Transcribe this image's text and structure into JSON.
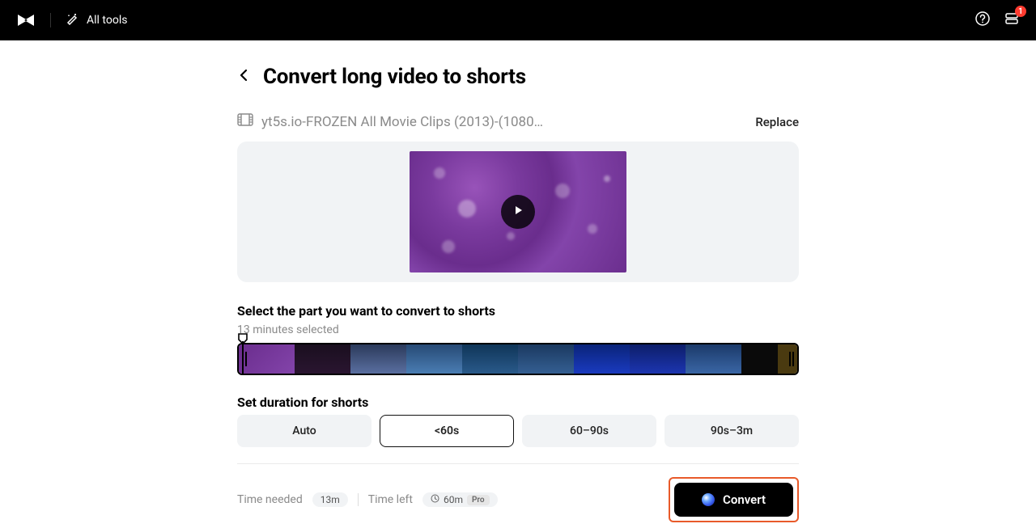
{
  "header": {
    "all_tools": "All tools",
    "notification_count": "1"
  },
  "page": {
    "title": "Convert long video to shorts",
    "file_name": "yt5s.io-FROZEN All Movie Clips (2013)-(1080…",
    "replace": "Replace"
  },
  "select": {
    "title": "Select the part you want to convert to shorts",
    "selected_text": "13 minutes selected"
  },
  "duration": {
    "title": "Set duration for shorts",
    "options": [
      "Auto",
      "<60s",
      "60–90s",
      "90s–3m"
    ],
    "selected_index": 1
  },
  "time": {
    "needed_label": "Time needed",
    "needed_value": "13m",
    "left_label": "Time left",
    "left_value": "60m",
    "left_badge": "Pro"
  },
  "actions": {
    "convert": "Convert"
  }
}
